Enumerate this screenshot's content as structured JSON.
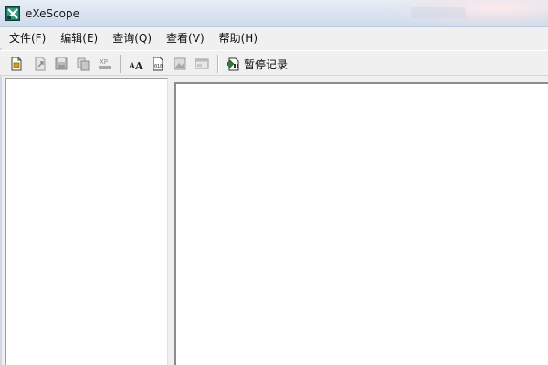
{
  "window": {
    "title": "eXeScope"
  },
  "menu": {
    "items": [
      {
        "id": "file",
        "label": "文件(F)"
      },
      {
        "id": "edit",
        "label": "编辑(E)"
      },
      {
        "id": "query",
        "label": "查询(Q)"
      },
      {
        "id": "view",
        "label": "查看(V)"
      },
      {
        "id": "help",
        "label": "帮助(H)"
      }
    ]
  },
  "toolbar": {
    "pause_label": "暂停记录",
    "icons": [
      "open-file-icon",
      "export-icon",
      "save-icon",
      "copy-icon",
      "xp-icon",
      "font-icon",
      "binary-icon",
      "image-icon",
      "dialog-icon",
      "pause-record-icon"
    ]
  },
  "colors": {
    "titlebar": "#dbe5f1",
    "chrome": "#f0f0f0",
    "pane": "#ffffff"
  }
}
